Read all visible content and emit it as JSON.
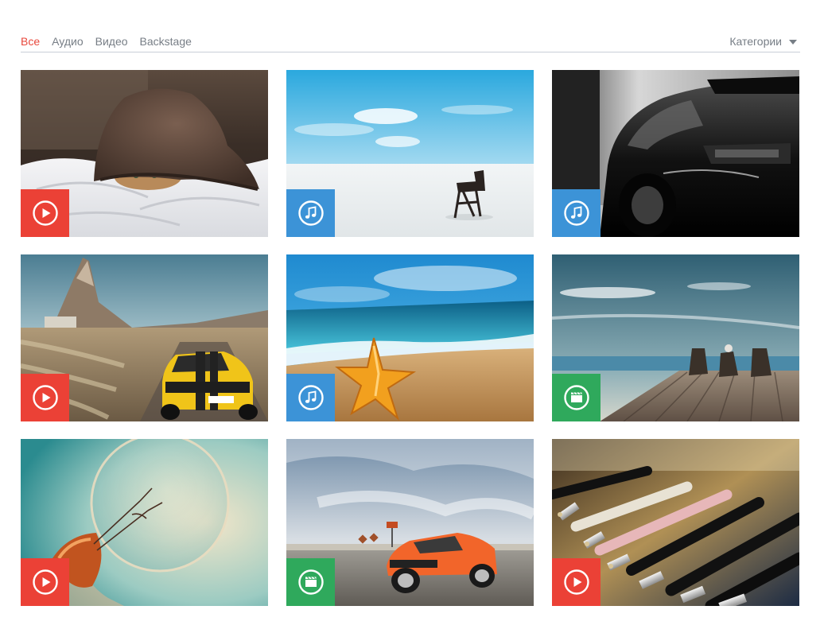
{
  "filters": {
    "tabs": [
      {
        "label": "Все",
        "active": true
      },
      {
        "label": "Аудио",
        "active": false
      },
      {
        "label": "Видео",
        "active": false
      },
      {
        "label": "Backstage",
        "active": false
      }
    ],
    "categories_label": "Категории"
  },
  "colors": {
    "accent": "#e8493d",
    "video_badge": "#eb4136",
    "audio_badge": "#3c93d7",
    "backstage_badge": "#2fa95c"
  },
  "items": [
    {
      "scene": "kitten-in-hat",
      "type": "video",
      "icon": "play-icon"
    },
    {
      "scene": "beach-chair",
      "type": "audio",
      "icon": "music-note-icon"
    },
    {
      "scene": "black-sports-car",
      "type": "audio",
      "icon": "music-note-icon"
    },
    {
      "scene": "yellow-camaro-desert",
      "type": "video",
      "icon": "play-icon"
    },
    {
      "scene": "starfish-beach",
      "type": "audio",
      "icon": "music-note-icon"
    },
    {
      "scene": "deck-chairs-sea",
      "type": "backstage",
      "icon": "clapperboard-icon"
    },
    {
      "scene": "light-bulb",
      "type": "video",
      "icon": "play-icon"
    },
    {
      "scene": "orange-muscle-car",
      "type": "backstage",
      "icon": "clapperboard-icon"
    },
    {
      "scene": "audio-jacks",
      "type": "video",
      "icon": "play-icon"
    }
  ]
}
